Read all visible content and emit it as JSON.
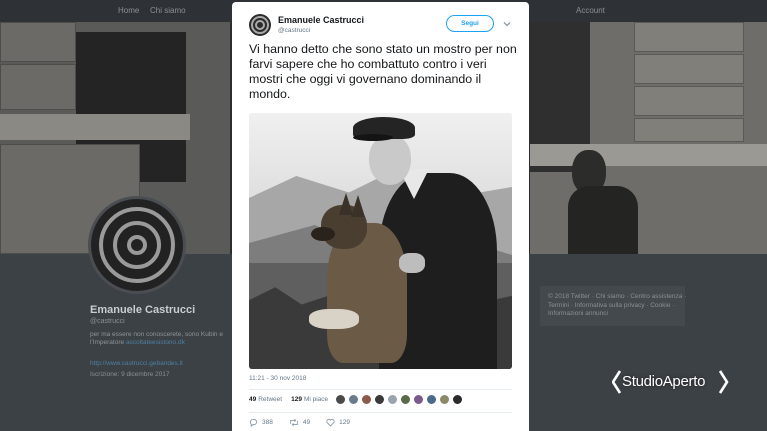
{
  "background_profile": {
    "nav_home": "Home",
    "nav_about": "Chi siamo",
    "nav_account": "Account",
    "name": "Emanuele Castrucci",
    "handle": "@castrucci",
    "bio": "per ma essere non conoscerete, sono Kubin e l'Imperatore",
    "bio_link": "ascoltateesistono.dk",
    "location_link": "http://www.castrucci.gebandes.it",
    "joined": "Iscrizione: 9 dicembre 2017",
    "footer": "© 2018 Twitter · Chi siamo · Centro assistenza · Termini · Informativa sulla privacy · Cookie · Informazioni annunci"
  },
  "tweet": {
    "author_name": "Emanuele Castrucci",
    "author_handle": "@castrucci",
    "follow_label": "Segui",
    "text": "Vi hanno detto che sono stato un mostro per non farvi sapere che ho combattuto contro i veri mostri che oggi vi governano dominando il mondo.",
    "timestamp": "11:21 - 30 nov 2018",
    "retweets_count": "49",
    "retweets_label": "Retweet",
    "likes_count": "129",
    "likes_label": "Mi piace",
    "replies_action": "388",
    "retweets_action": "49",
    "likes_action": "129"
  },
  "colors": {
    "accent": "#1da1f2",
    "text": "#14171a",
    "muted": "#657786"
  },
  "liker_face_colors": [
    "#4a4a4a",
    "#6a7b8c",
    "#8c5a4a",
    "#3a3a3a",
    "#9aa4ad",
    "#5a6a4a",
    "#7a5a8a",
    "#4a6a8a",
    "#8a8a6a",
    "#2a2a2a"
  ],
  "channel_logo": "StudioAperto"
}
